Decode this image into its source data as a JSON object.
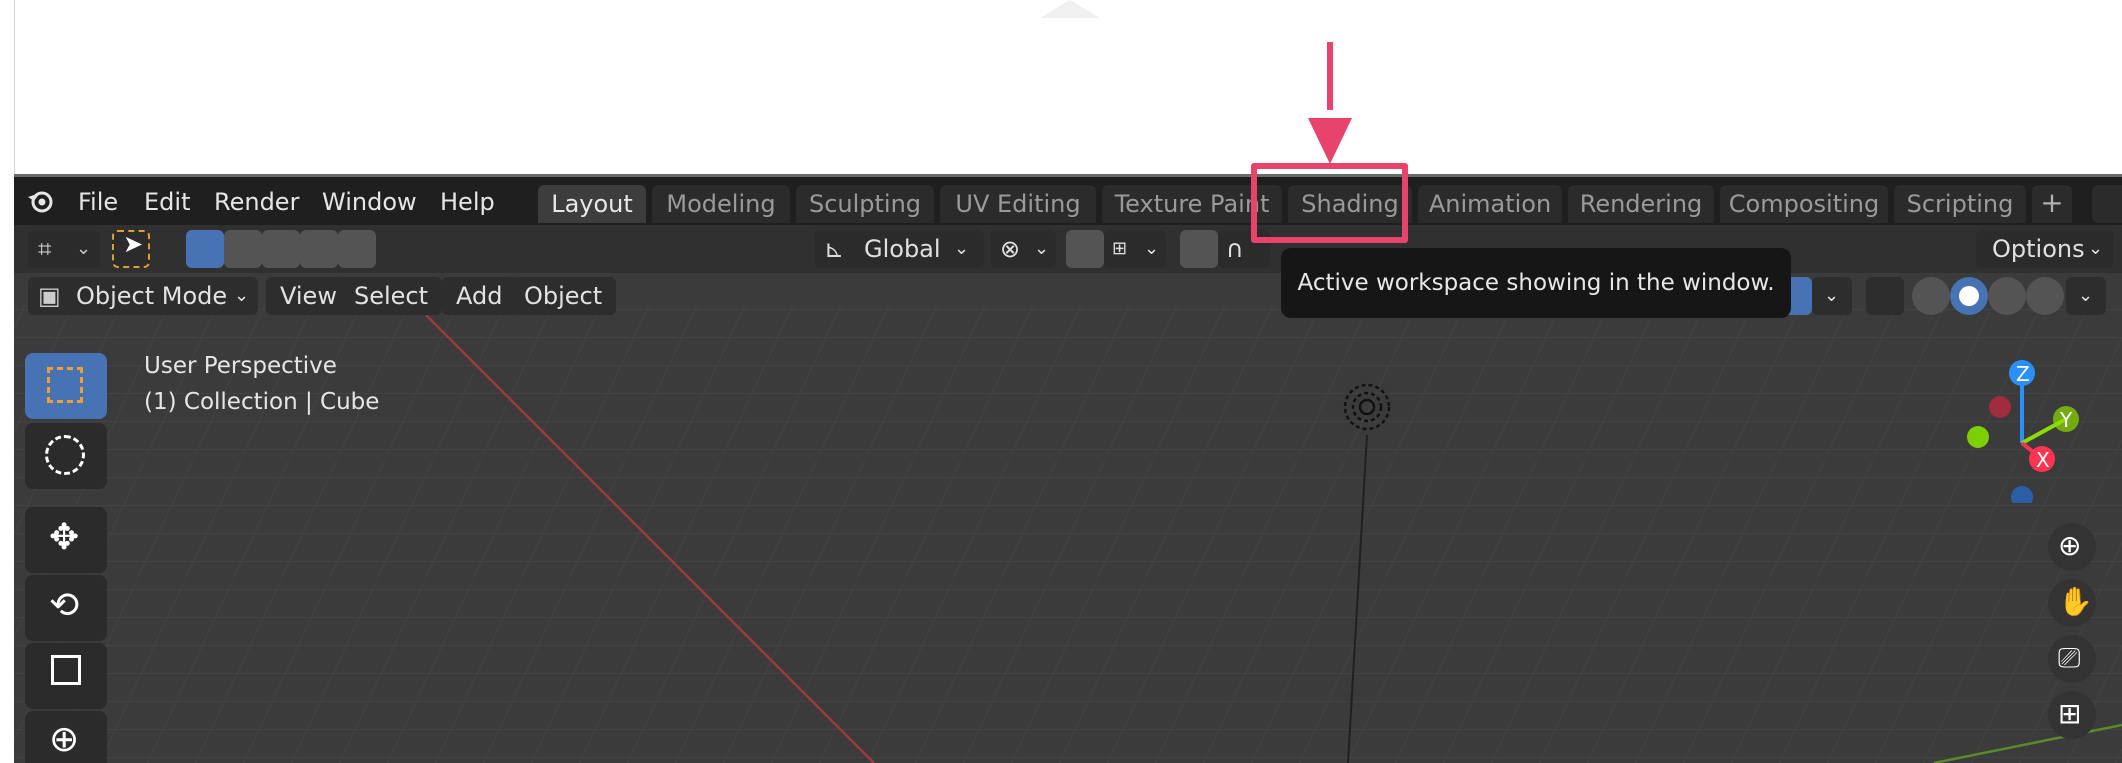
{
  "menu": {
    "file": "File",
    "edit": "Edit",
    "render": "Render",
    "window": "Window",
    "help": "Help"
  },
  "workspaces": {
    "layout": "Layout",
    "modeling": "Modeling",
    "sculpting": "Sculpting",
    "uv_editing": "UV Editing",
    "texture_paint": "Texture Paint",
    "shading": "Shading",
    "animation": "Animation",
    "rendering": "Rendering",
    "compositing": "Compositing",
    "scripting": "Scripting",
    "add": "+"
  },
  "toolheader": {
    "transform_orientation": "Global",
    "options": "Options"
  },
  "viewport_header": {
    "mode": "Object Mode",
    "view": "View",
    "select": "Select",
    "add": "Add",
    "object": "Object"
  },
  "viewport": {
    "perspective": "User Perspective",
    "collection": "(1) Collection | Cube"
  },
  "gizmo": {
    "z": "Z",
    "y": "Y",
    "x": "X"
  },
  "tooltip": {
    "text": "Active workspace showing in the window."
  },
  "colors": {
    "highlight": "#e8436b",
    "active_tool": "#4772b3",
    "axis_x": "#ff3352",
    "axis_y": "#8bdc00",
    "axis_z": "#2890ff"
  }
}
